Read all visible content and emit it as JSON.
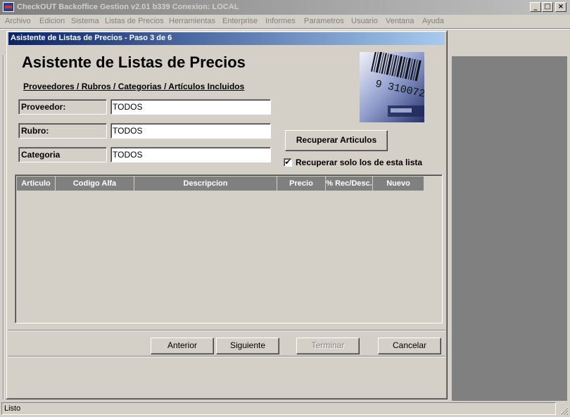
{
  "window": {
    "title": "CheckOUT Backoffice Gestion v2.01 b339 Conexion: LOCAL",
    "minimize_glyph": "_",
    "maximize_glyph": "□",
    "close_glyph": "×"
  },
  "menu": {
    "items": [
      {
        "label": "Archivo"
      },
      {
        "label": "Edicion"
      },
      {
        "label": "Sistema"
      },
      {
        "label": "Listas de Precios"
      },
      {
        "label": "Herramientas"
      },
      {
        "label": "Enterprise"
      },
      {
        "label": "Informes"
      },
      {
        "label": "Parametros"
      },
      {
        "label": "Usuario"
      },
      {
        "label": "Ventana"
      },
      {
        "label": "Ayuda"
      }
    ]
  },
  "dialog": {
    "title": "Asistente de Listas de Precios - Paso 3 de 6",
    "heading": "Asistente de Listas de Precios",
    "subtitle": "Proveedores / Rubros / Categorias / Artículos Incluidos",
    "image_text": "9 310072",
    "fields": [
      {
        "label": "Proveedor:",
        "value": "TODOS"
      },
      {
        "label": "Rubro:",
        "value": "TODOS"
      },
      {
        "label": "Categoria",
        "value": "TODOS"
      }
    ],
    "retrieve_button": "Recuperar Articulos",
    "checkbox": {
      "label": "Recuperar solo los de esta lista",
      "checked": true,
      "glyph": "✔"
    },
    "grid": {
      "columns": [
        "Articulo",
        "Codigo Alfa",
        "Descripcion",
        "Precio",
        "% Rec/Desc.",
        "Nuevo"
      ],
      "rows": []
    },
    "buttons": {
      "previous": {
        "label": "Anterior",
        "enabled": true
      },
      "next": {
        "label": "Siguiente",
        "enabled": true
      },
      "finish": {
        "label": "Terminar",
        "enabled": false
      },
      "cancel": {
        "label": "Cancelar",
        "enabled": true
      }
    }
  },
  "statusbar": {
    "text": "Listo"
  },
  "colors": {
    "face": "#d4d0c8",
    "active_title_start": "#0a246a",
    "active_title_end": "#a6caf0",
    "mdi_background": "#808080"
  }
}
